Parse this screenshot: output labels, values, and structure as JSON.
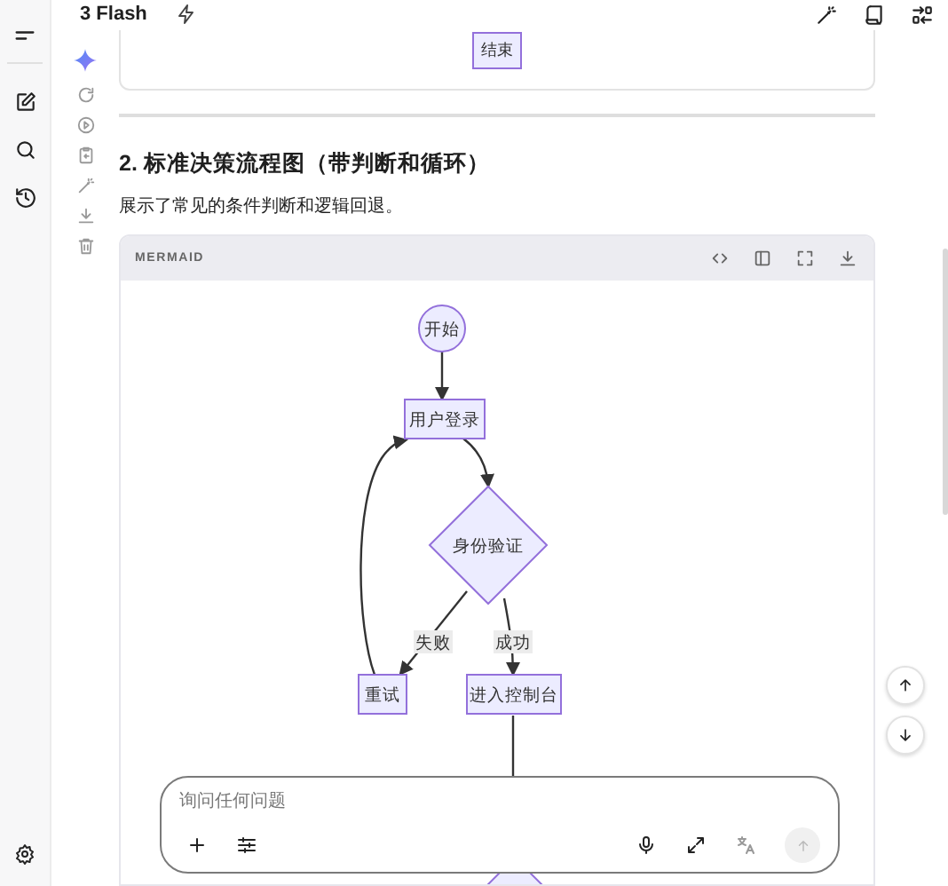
{
  "header": {
    "title": "3 Flash"
  },
  "previous_diagram": {
    "nodes": [
      {
        "kind": "rect",
        "label": "结束"
      }
    ]
  },
  "section": {
    "heading": "2. 标准决策流程图（带判断和循环）",
    "description": "展示了常见的条件判断和逻辑回退。"
  },
  "code_block": {
    "language": "MERMAID",
    "diagram": {
      "nodes": [
        {
          "kind": "circle",
          "label": "开始"
        },
        {
          "kind": "rect",
          "label": "用户登录"
        },
        {
          "kind": "diamond",
          "label": "身份验证"
        },
        {
          "kind": "rect",
          "label": "重试"
        },
        {
          "kind": "rect",
          "label": "进入控制台"
        },
        {
          "kind": "diamond"
        }
      ],
      "edge_labels": [
        "失败",
        "成功"
      ]
    }
  },
  "composer": {
    "placeholder": "询问任何问题"
  }
}
